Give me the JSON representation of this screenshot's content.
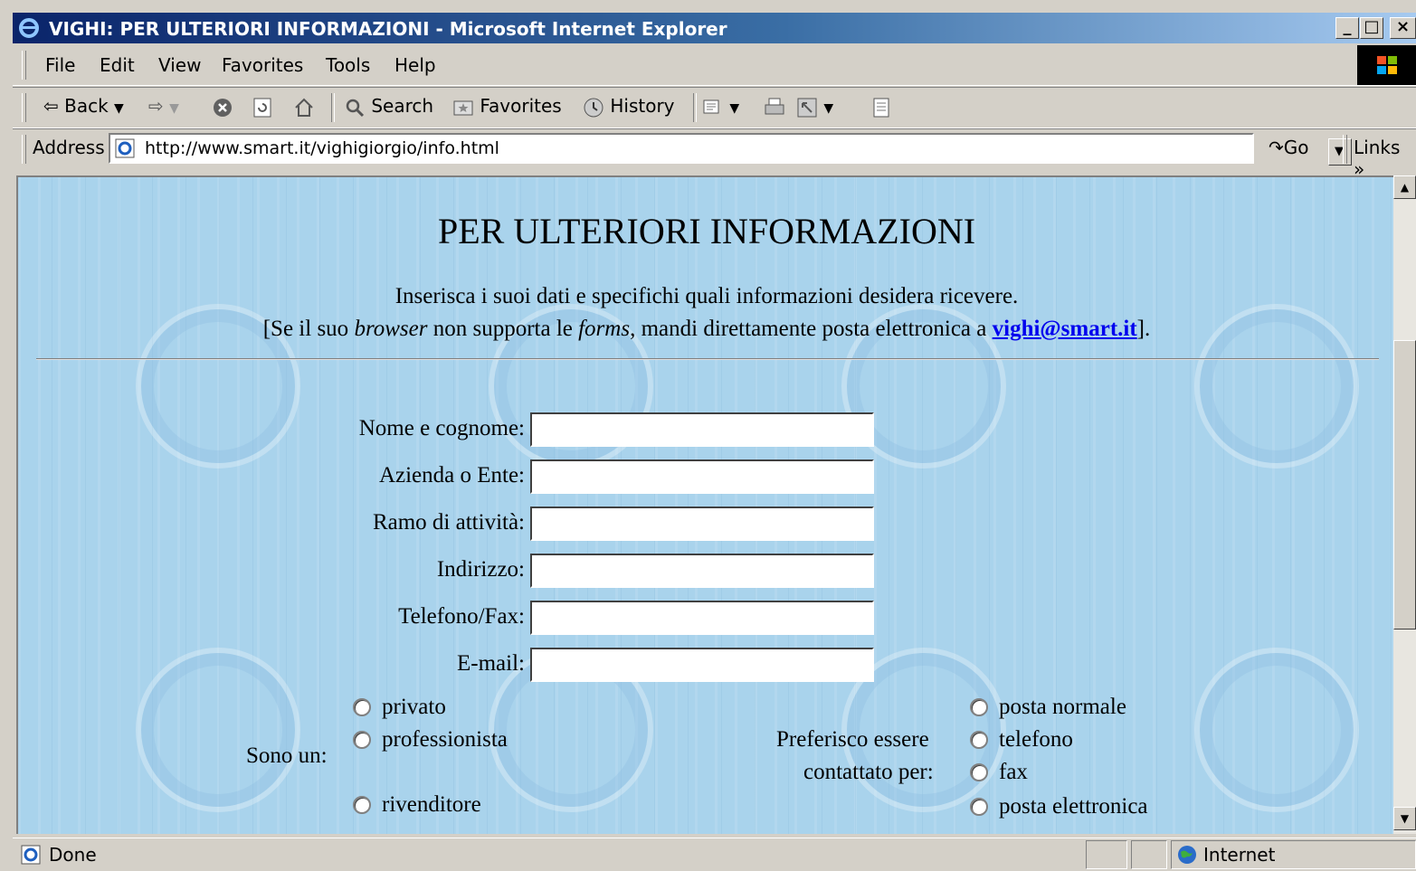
{
  "window": {
    "title": "VIGHI: PER ULTERIORI INFORMAZIONI - Microsoft Internet Explorer",
    "controls": {
      "minimize": "_",
      "maximize": "□",
      "close": "×"
    }
  },
  "menu": [
    "File",
    "Edit",
    "View",
    "Favorites",
    "Tools",
    "Help"
  ],
  "toolbar": {
    "back": "Back",
    "search": "Search",
    "favorites": "Favorites",
    "history": "History"
  },
  "address": {
    "label": "Address",
    "url": "http://www.smart.it/vighigiorgio/info.html",
    "go": "Go",
    "links": "Links"
  },
  "page": {
    "title": "PER ULTERIORI INFORMAZIONI",
    "intro_line1": "Inserisca i suoi dati e specifichi quali informazioni desidera ricevere.",
    "intro_line2": {
      "part1": "[Se il suo ",
      "browser": "browser",
      "part2": " non supporta le ",
      "forms": "forms",
      "part3": ", mandi direttamente posta elettronica a ",
      "email": "vighi@smart.it",
      "part4": "]."
    },
    "fields": [
      {
        "label": "Nome e cognome:",
        "value": ""
      },
      {
        "label": "Azienda o Ente:",
        "value": ""
      },
      {
        "label": "Ramo di attività:",
        "value": ""
      },
      {
        "label": "Indirizzo:",
        "value": ""
      },
      {
        "label": "Telefono/Fax:",
        "value": ""
      },
      {
        "label": "E-mail:",
        "value": ""
      }
    ],
    "sono_un": {
      "label": "Sono un:",
      "options": [
        "privato",
        "professionista",
        "rivenditore"
      ]
    },
    "contatto": {
      "label_line1": "Preferisco essere",
      "label_line2": "contattato per:",
      "options": [
        "posta normale",
        "telefono",
        "fax",
        "posta elettronica"
      ]
    }
  },
  "status": {
    "text": "Done",
    "zone": "Internet"
  }
}
